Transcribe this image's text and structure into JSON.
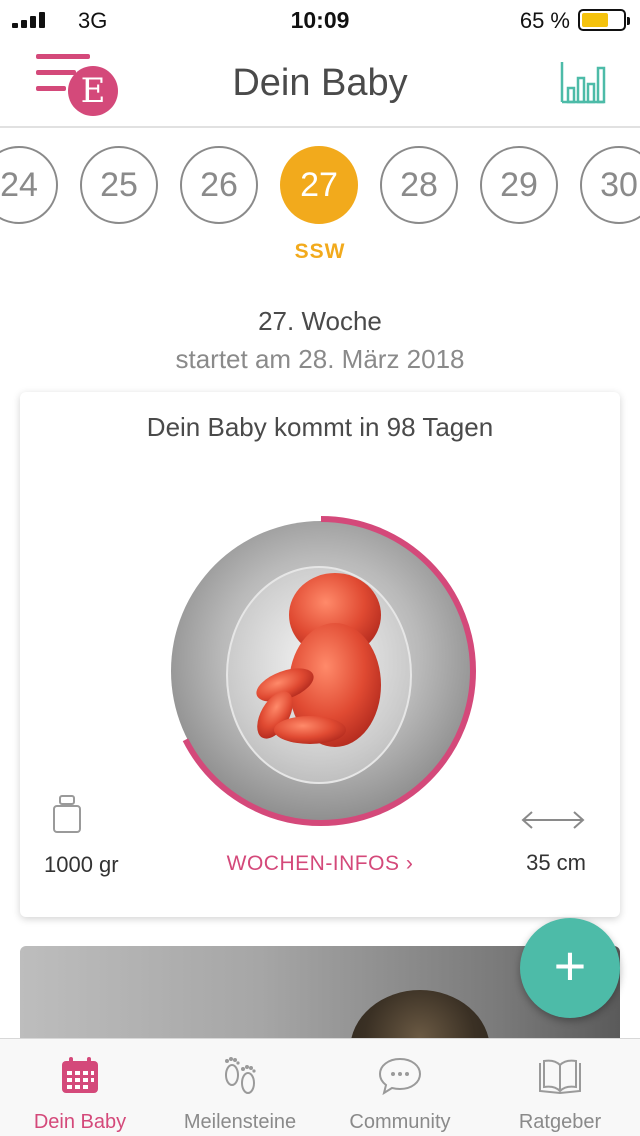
{
  "status_bar": {
    "carrier": "3G",
    "time": "10:09",
    "battery_percent": "65 %",
    "battery_level": 0.65
  },
  "header": {
    "logo_letter": "E",
    "title": "Dein Baby",
    "accent_color": "#d4497a",
    "stats_color": "#4dbba8"
  },
  "weeks": {
    "items": [
      "24",
      "25",
      "26",
      "27",
      "28",
      "29",
      "30"
    ],
    "selected": "27",
    "label": "SSW",
    "selected_color": "#f2aa1c"
  },
  "week_info": {
    "title": "27. Woche",
    "start": "startet am 28. März 2018"
  },
  "card": {
    "countdown": "Dein Baby kommt in 98 Tagen",
    "weight": "1000 gr",
    "length": "35 cm",
    "link": "WOCHEN-INFOS",
    "link_chevron": "›",
    "progress_fraction": 0.675
  },
  "fab": {
    "symbol": "+"
  },
  "tabbar": {
    "items": [
      {
        "label": "Dein Baby",
        "icon": "calendar-icon",
        "active": true
      },
      {
        "label": "Meilensteine",
        "icon": "footprints-icon",
        "active": false
      },
      {
        "label": "Community",
        "icon": "chat-bubble-icon",
        "active": false
      },
      {
        "label": "Ratgeber",
        "icon": "book-icon",
        "active": false
      }
    ]
  }
}
